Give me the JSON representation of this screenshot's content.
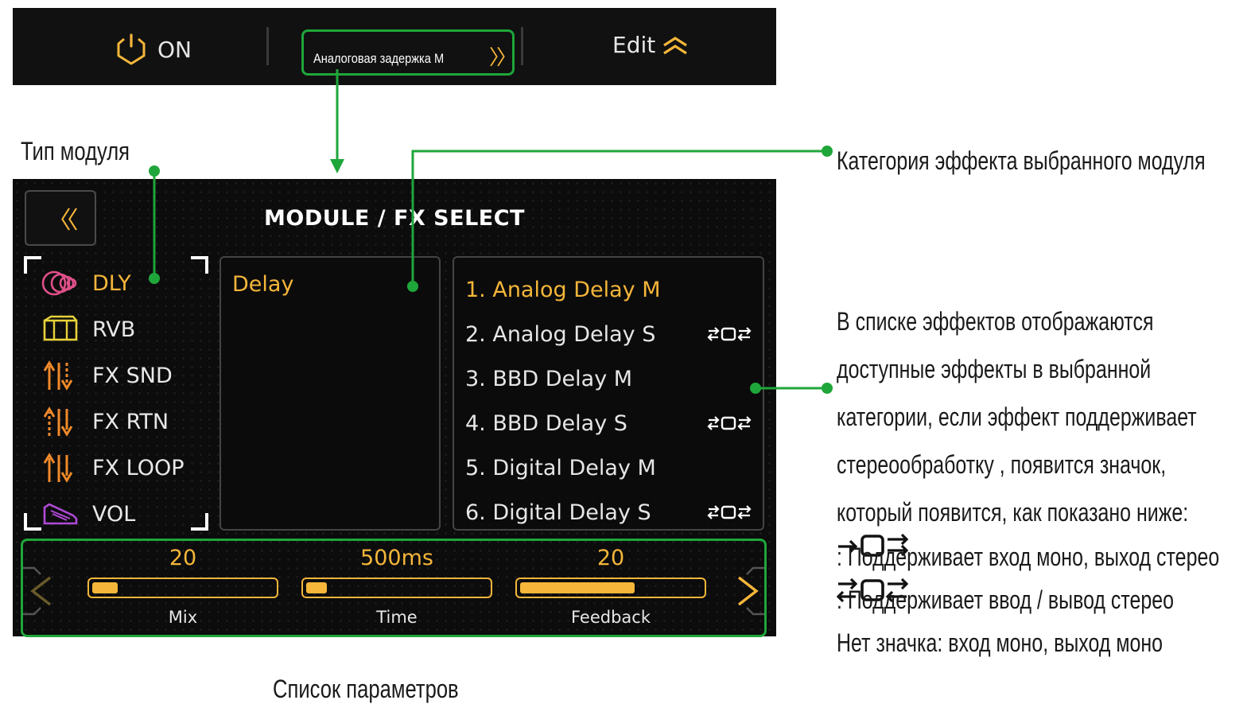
{
  "topbar": {
    "power_label": "ON",
    "module_name": "Аналоговая задержка M",
    "edit_label": "Edit"
  },
  "screen": {
    "title": "MODULE / FX SELECT",
    "module_types": [
      {
        "label": "DLY",
        "icon": "delay-rings-icon",
        "color": "#e0508a",
        "active": true
      },
      {
        "label": "RVB",
        "icon": "reverb-cube-icon",
        "color": "#e8d23a",
        "active": false
      },
      {
        "label": "FX SND",
        "icon": "fx-send-icon",
        "color": "#f08a2a",
        "active": false
      },
      {
        "label": "FX RTN",
        "icon": "fx-return-icon",
        "color": "#f08a2a",
        "active": false
      },
      {
        "label": "FX LOOP",
        "icon": "fx-loop-icon",
        "color": "#f08a2a",
        "active": false
      },
      {
        "label": "VOL",
        "icon": "volume-pedal-icon",
        "color": "#b04ad8",
        "active": false
      }
    ],
    "category": "Delay",
    "effects": [
      {
        "label": "1. Analog Delay M",
        "stereo_icon": "",
        "active": true
      },
      {
        "label": "2. Analog Delay S",
        "stereo_icon": "stereo-in-out-icon",
        "active": false
      },
      {
        "label": "3. BBD Delay M",
        "stereo_icon": "",
        "active": false
      },
      {
        "label": "4. BBD Delay S",
        "stereo_icon": "stereo-in-out-icon",
        "active": false
      },
      {
        "label": "5. Digital Delay M",
        "stereo_icon": "",
        "active": false
      },
      {
        "label": "6. Digital Delay S",
        "stereo_icon": "stereo-in-out-icon",
        "active": false
      }
    ],
    "params": [
      {
        "value": "20",
        "label": "Mix",
        "fill": 0.14
      },
      {
        "value": "500ms",
        "label": "Time",
        "fill": 0.11
      },
      {
        "value": "20",
        "label": "Feedback",
        "fill": 0.62
      }
    ]
  },
  "annotations": {
    "module_type": "Тип модуля",
    "category": "Категория эффекта выбранного модуля",
    "params": "Список параметров",
    "list_lines": [
      "В списке эффектов отображаются",
      "доступные эффекты в выбранной",
      "категории, если эффект поддерживает",
      "стереообработку , появится значок,",
      "который появится, как показано ниже:"
    ],
    "legend_mono_in_stereo_out": ": Поддерживает вход моно, выход стерео",
    "legend_stereo_in_out": ": Поддерживает ввод / вывод стерео",
    "legend_none": "Нет значка: вход моно, выход моно"
  },
  "colors": {
    "accent": "#f5b63a",
    "callout_green": "#1fa63a",
    "screen_bg": "#0c0c0c"
  }
}
